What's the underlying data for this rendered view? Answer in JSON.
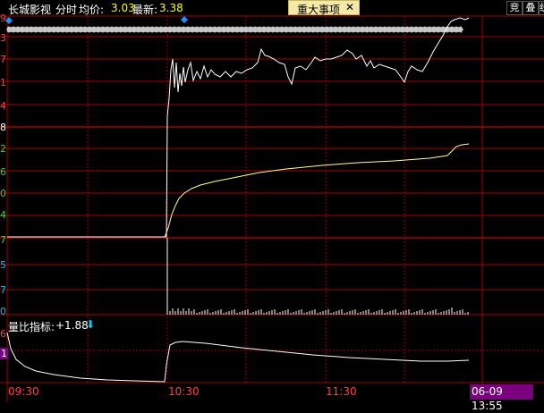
{
  "header": {
    "stock_name": "长城影视",
    "mode": "分时",
    "avg_label": "均价:",
    "avg_value": "3.03",
    "last_label": "最新:",
    "last_value": "3.38",
    "news_button": "重大事项",
    "news_close": "✕",
    "right_buttons": [
      "竞",
      "叠",
      "统"
    ]
  },
  "price_axis_labels": [
    {
      "text": "9",
      "color": "#ff4040"
    },
    {
      "text": "3",
      "color": "#ff4040"
    },
    {
      "text": "7",
      "color": "#ff4040"
    },
    {
      "text": "1",
      "color": "#ff4040"
    },
    {
      "text": "4",
      "color": "#ff4040"
    },
    {
      "text": "8",
      "color": "#ffffff"
    },
    {
      "text": "2",
      "color": "#3cd040"
    },
    {
      "text": "6",
      "color": "#3cd040"
    },
    {
      "text": "0",
      "color": "#3cd040"
    },
    {
      "text": "4",
      "color": "#3cd040"
    },
    {
      "text": "7",
      "color": "#3cd040"
    },
    {
      "text": "5",
      "color": "#00c0ff"
    },
    {
      "text": "7",
      "color": "#00c0ff"
    },
    {
      "text": "0",
      "color": "#00c0ff"
    }
  ],
  "indicator": {
    "label": "量比指标:",
    "value": "+1.88",
    "arrow": "⬇",
    "axis_labels": [
      {
        "text": "6",
        "color": "#ff4040"
      },
      {
        "text": "1",
        "color": "#ff4040"
      }
    ]
  },
  "time_labels": [
    "09:30",
    "10:30",
    "11:30"
  ],
  "date_time": "06-09 13:55",
  "colors": {
    "grid": "#a00000",
    "price_line": "#ffffff",
    "avg_line": "#ffff99",
    "volume": "#ffffff",
    "event_strip": "#b0b0b0",
    "event_marker": "#2090ff"
  },
  "chart_data": {
    "type": "line",
    "x": [
      "09:30",
      "10:30",
      "11:30"
    ],
    "series": [],
    "ylim": []
  }
}
